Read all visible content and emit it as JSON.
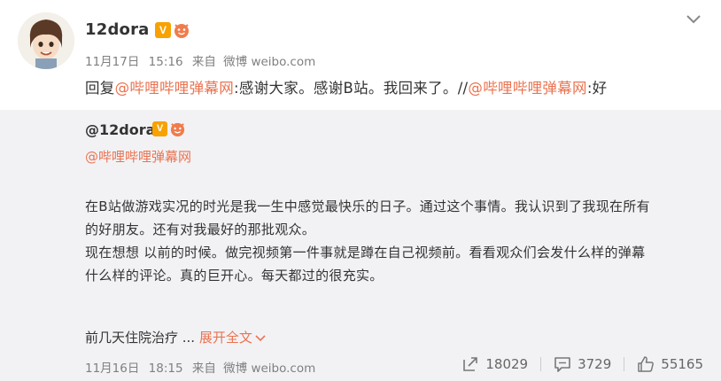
{
  "post": {
    "username": "12dora",
    "verified_badge": "V",
    "meta": {
      "date": "11月17日",
      "time": "15:16",
      "source_prefix": "来自",
      "source": "微博 weibo.com"
    },
    "text": {
      "prefix": "回复",
      "mention1": "@哔哩哔哩弹幕网",
      "middle": ":感谢大家。感谢B站。我回来了。//",
      "mention2": "@哔哩哔哩弹幕网",
      "suffix": ":好"
    }
  },
  "repost": {
    "username": "@12dora",
    "verified_badge": "V",
    "mention": "@哔哩哔哩弹幕网",
    "paragraphs": [
      "在B站做游戏实况的时光是我一生中感觉最快乐的日子。通过这个事情。我认识到了我现在所有",
      "的好朋友。还有对我最好的那批观众。",
      "现在想想 以前的时候。做完视频第一件事就是蹲在自己视频前。看看观众们会发什么样的弹幕",
      "什么样的评论。真的巨开心。每天都过的很充实。"
    ],
    "preview_text": "前几天住院治疗 ...",
    "expand_label": "展开全文",
    "meta": {
      "date": "11月16日",
      "time": "18:15",
      "source_prefix": "来自",
      "source": "微博 weibo.com"
    },
    "actions": {
      "repost_count": "18029",
      "comment_count": "3729",
      "like_count": "55165"
    }
  },
  "icons": {
    "top_right": "chevron-down-icon",
    "expand": "chevron-down-icon",
    "repost": "repost-icon",
    "comment": "comment-icon",
    "like": "thumbs-up-icon",
    "member": "member-badge-icon"
  },
  "colors": {
    "mention": "#eb7350",
    "verified": "#f7a200",
    "repost_bg": "#f2f2f5",
    "meta_text": "#808080"
  }
}
